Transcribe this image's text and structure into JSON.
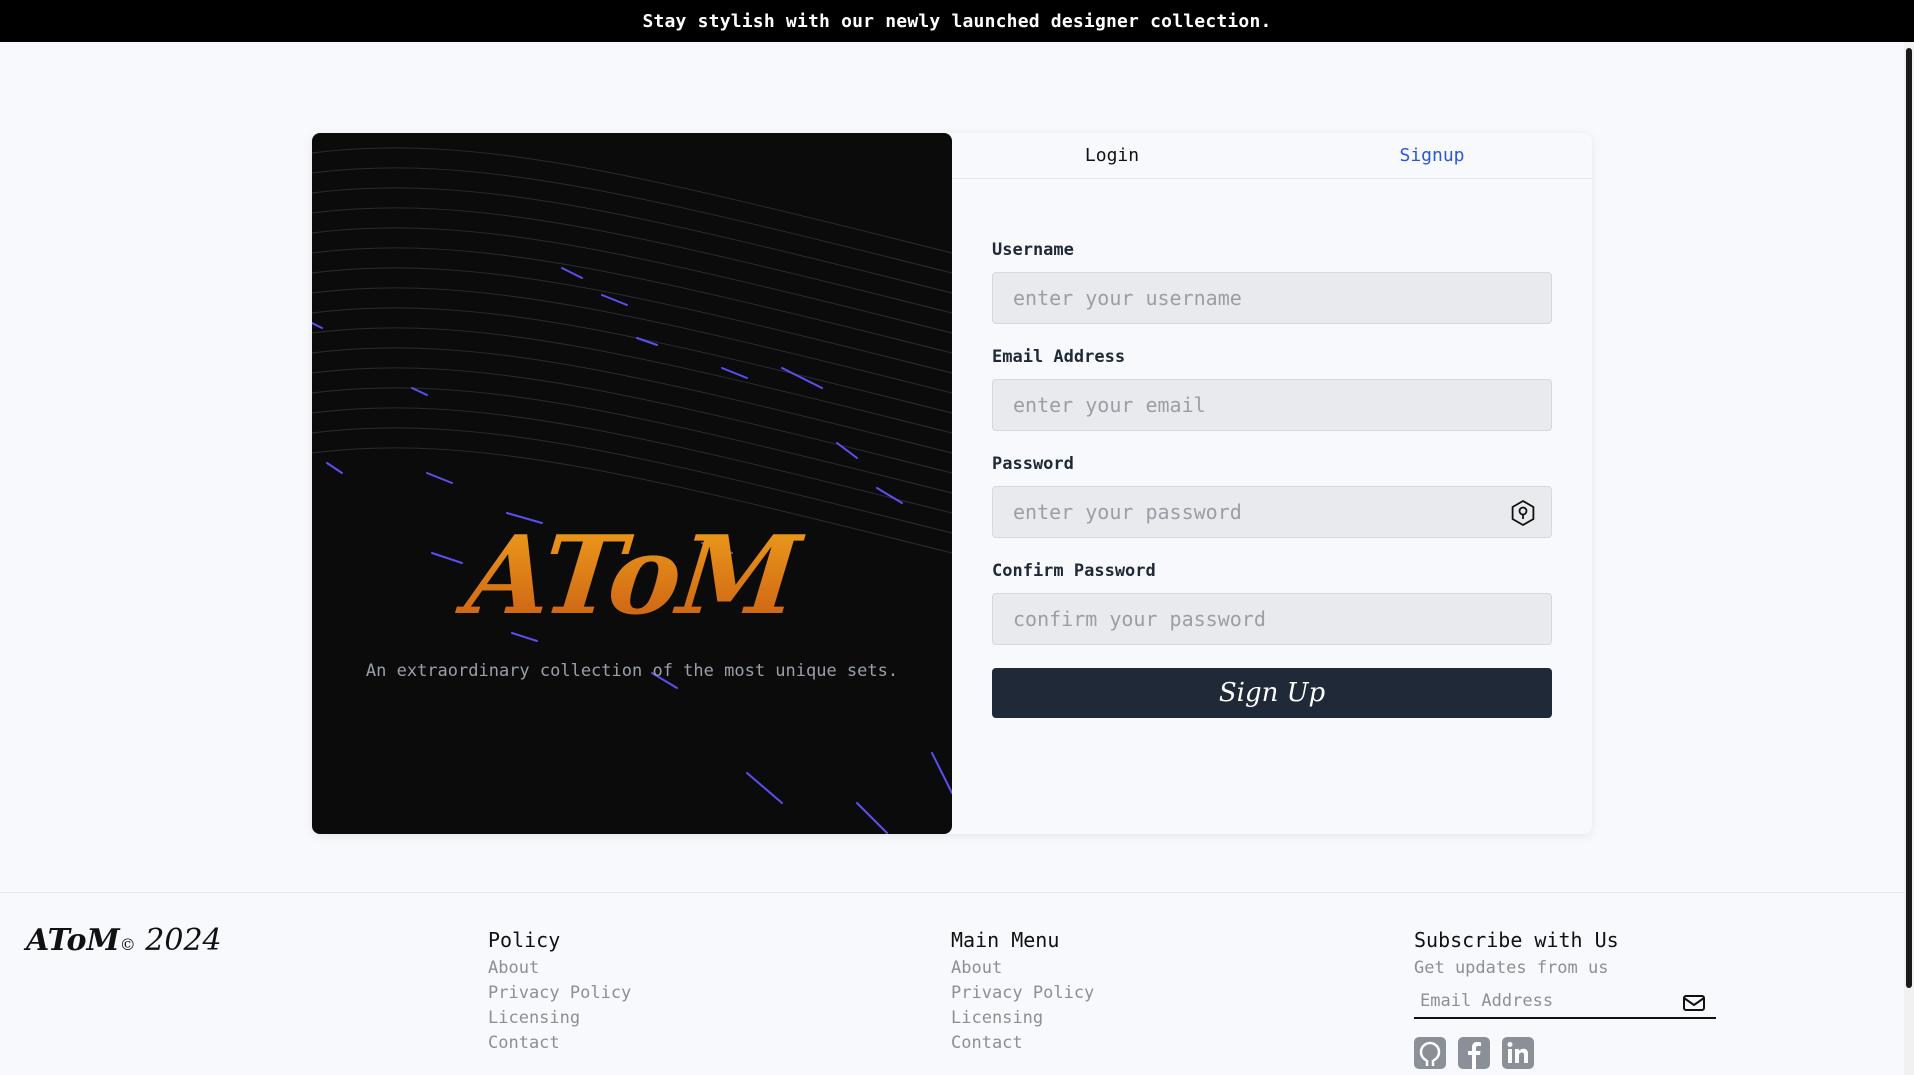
{
  "announcement": "Stay stylish with our newly launched designer collection.",
  "hero": {
    "logo": "AToM",
    "tagline": "An extraordinary collection of the most unique sets."
  },
  "tabs": {
    "login": "Login",
    "signup": "Signup"
  },
  "form": {
    "username_label": "Username",
    "username_placeholder": "enter your username",
    "email_label": "Email Address",
    "email_placeholder": "enter your email",
    "password_label": "Password",
    "password_placeholder": "enter your password",
    "confirm_label": "Confirm Password",
    "confirm_placeholder": "confirm your password",
    "submit_label": "Sign Up"
  },
  "footer": {
    "brand": "AToM",
    "copyright_symbol": "©",
    "year": "2024",
    "policy": {
      "title": "Policy",
      "links": [
        "About",
        "Privacy Policy",
        "Licensing",
        "Contact"
      ]
    },
    "main_menu": {
      "title": "Main Menu",
      "links": [
        "About",
        "Privacy Policy",
        "Licensing",
        "Contact"
      ]
    },
    "subscribe": {
      "title": "Subscribe with Us",
      "subtitle": "Get updates from us",
      "placeholder": "Email Address"
    },
    "socials": [
      "github-icon",
      "facebook-icon",
      "linkedin-icon"
    ]
  },
  "colors": {
    "accent": "#2b56d9",
    "button": "#1f2937",
    "logo_gradient_top": "#f0a11c",
    "logo_gradient_bottom": "#c85a14"
  }
}
